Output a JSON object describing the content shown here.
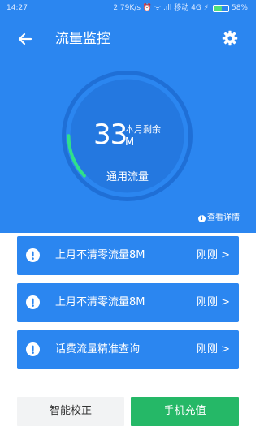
{
  "status_bar": {
    "time": "14:27",
    "right_text": "2.79K/s ⏰ ᯤ .ıll 移动 4G ⚡",
    "battery": "58%",
    "battery_level": 0.58
  },
  "header": {
    "title": "流量监控"
  },
  "gauge": {
    "value": "33",
    "caption": "本月剩余",
    "unit": "M",
    "label": "通用流量",
    "progress": 0.12
  },
  "details_link": "查看详情",
  "notices": [
    {
      "text": "上月不清零流量8M",
      "time": "刚刚 >"
    },
    {
      "text": "上月不清零流量8M",
      "time": "刚刚 >"
    },
    {
      "text": "话费流量精准查询",
      "time": "刚刚 >"
    }
  ],
  "buttons": {
    "calibrate": "智能校正",
    "recharge": "手机充值"
  },
  "colors": {
    "primary": "#2b86f0",
    "gauge_inner": "#2478e0",
    "gauge_track": "#1f6fd6",
    "progress": "#2fe08a",
    "recharge": "#25b867"
  }
}
